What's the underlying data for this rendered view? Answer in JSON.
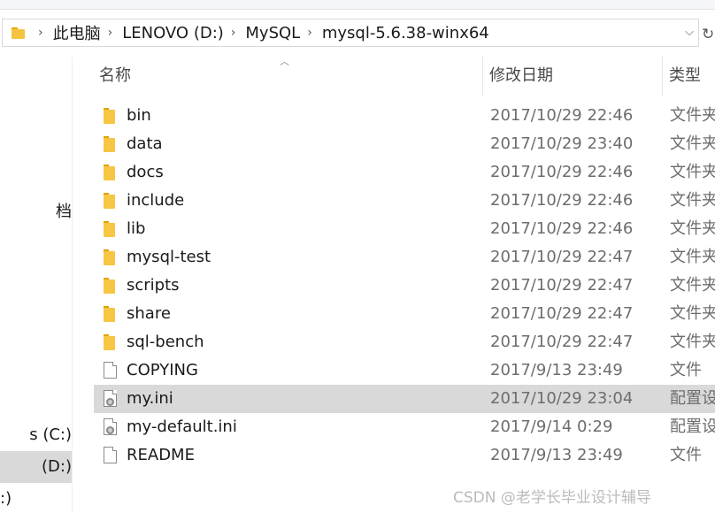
{
  "address_bar": {
    "crumbs": [
      "此电脑",
      "LENOVO (D:)",
      "MySQL",
      "mysql-5.6.38-winx64"
    ],
    "dropdown_icon": "chevron-down-icon",
    "refresh_icon": "refresh-icon"
  },
  "nav_pane": {
    "items": [
      {
        "label": "档"
      },
      {
        "label": "s (C:)"
      },
      {
        "label": " (D:)"
      },
      {
        "label": ":)"
      }
    ]
  },
  "columns": {
    "name": "名称",
    "date": "修改日期",
    "type": "类型"
  },
  "files": [
    {
      "name": "bin",
      "date": "2017/10/29 22:46",
      "type": "文件夹",
      "icon": "folder-icon"
    },
    {
      "name": "data",
      "date": "2017/10/29 23:40",
      "type": "文件夹",
      "icon": "folder-icon"
    },
    {
      "name": "docs",
      "date": "2017/10/29 22:46",
      "type": "文件夹",
      "icon": "folder-icon"
    },
    {
      "name": "include",
      "date": "2017/10/29 22:46",
      "type": "文件夹",
      "icon": "folder-icon"
    },
    {
      "name": "lib",
      "date": "2017/10/29 22:46",
      "type": "文件夹",
      "icon": "folder-icon"
    },
    {
      "name": "mysql-test",
      "date": "2017/10/29 22:47",
      "type": "文件夹",
      "icon": "folder-icon"
    },
    {
      "name": "scripts",
      "date": "2017/10/29 22:47",
      "type": "文件夹",
      "icon": "folder-icon"
    },
    {
      "name": "share",
      "date": "2017/10/29 22:47",
      "type": "文件夹",
      "icon": "folder-icon"
    },
    {
      "name": "sql-bench",
      "date": "2017/10/29 22:47",
      "type": "文件夹",
      "icon": "folder-icon"
    },
    {
      "name": "COPYING",
      "date": "2017/9/13 23:49",
      "type": "文件",
      "icon": "file-icon"
    },
    {
      "name": "my.ini",
      "date": "2017/10/29 23:04",
      "type": "配置设置",
      "icon": "ini-file-icon",
      "selected": true
    },
    {
      "name": "my-default.ini",
      "date": "2017/9/14 0:29",
      "type": "配置设置",
      "icon": "ini-file-icon"
    },
    {
      "name": "README",
      "date": "2017/9/13 23:49",
      "type": "文件",
      "icon": "file-icon"
    }
  ],
  "watermark": "CSDN @老学长毕业设计辅导",
  "colors": {
    "selected_row": "#d9d9d9",
    "folder": "#f6c644"
  }
}
